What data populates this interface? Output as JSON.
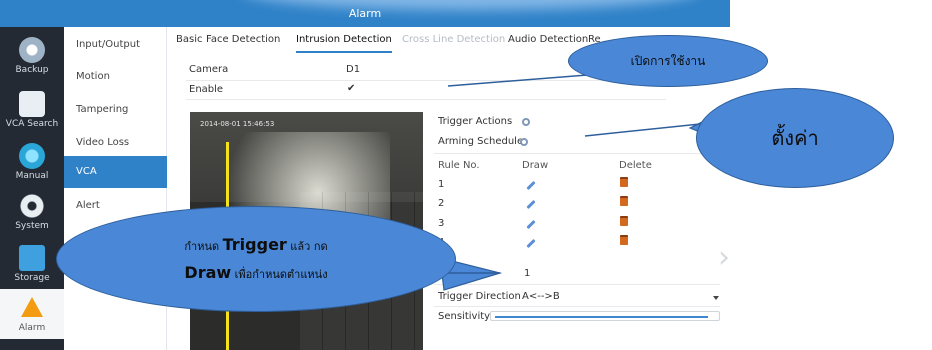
{
  "window": {
    "title": "Alarm"
  },
  "leftnav": {
    "items": [
      {
        "label": "Backup",
        "icon": "backup-icon"
      },
      {
        "label": "VCA Search",
        "icon": "search-icon"
      },
      {
        "label": "Manual",
        "icon": "manual-icon"
      },
      {
        "label": "System",
        "icon": "gear-icon"
      },
      {
        "label": "Storage",
        "icon": "storage-icon"
      },
      {
        "label": "Alarm",
        "icon": "alarm-icon"
      }
    ]
  },
  "submenu": {
    "items": [
      {
        "label": "Input/Output"
      },
      {
        "label": "Motion"
      },
      {
        "label": "Tampering"
      },
      {
        "label": "Video Loss"
      },
      {
        "label": "VCA"
      },
      {
        "label": "Alert"
      }
    ]
  },
  "tabs": [
    {
      "label": "Basic"
    },
    {
      "label": "Face Detection"
    },
    {
      "label": "Intrusion Detection"
    },
    {
      "label": "Cross Line Detection"
    },
    {
      "label": "Audio Detection"
    },
    {
      "label": "Re"
    }
  ],
  "form": {
    "camera_label": "Camera",
    "camera_value": "D1",
    "enable_label": "Enable",
    "enable_value": "✔"
  },
  "video": {
    "timestamp": "2014-08-01 15:46:53"
  },
  "settings": {
    "trigger_actions_label": "Trigger Actions",
    "arming_schedule_label": "Arming Schedule"
  },
  "rules": {
    "headers": {
      "rule_no": "Rule No.",
      "draw": "Draw",
      "delete": "Delete"
    },
    "rows": [
      {
        "no": "1"
      },
      {
        "no": "2"
      },
      {
        "no": "3"
      },
      {
        "no": "4"
      }
    ],
    "selected_rule": "1",
    "trigger_direction_label": "Trigger Direction",
    "trigger_direction_value": "A<-->B",
    "sensitivity_label": "Sensitivity",
    "sensitivity_level": 0.97
  },
  "annotations": {
    "enable_note": "เปิดการใช้งาน",
    "settings_note": "ตั้งค่า",
    "draw_note_line1_pre": "กำหนด ",
    "draw_note_line1_bold": "Trigger",
    "draw_note_line1_post": " แล้ว  กด",
    "draw_note_line2_bold": "Draw",
    "draw_note_line2_post": "  เพื่อกำหนดตำแหน่ง"
  },
  "colors": {
    "accent": "#2f82c8",
    "callout": "#4a87d6",
    "trip_line": "#f4e31b"
  }
}
